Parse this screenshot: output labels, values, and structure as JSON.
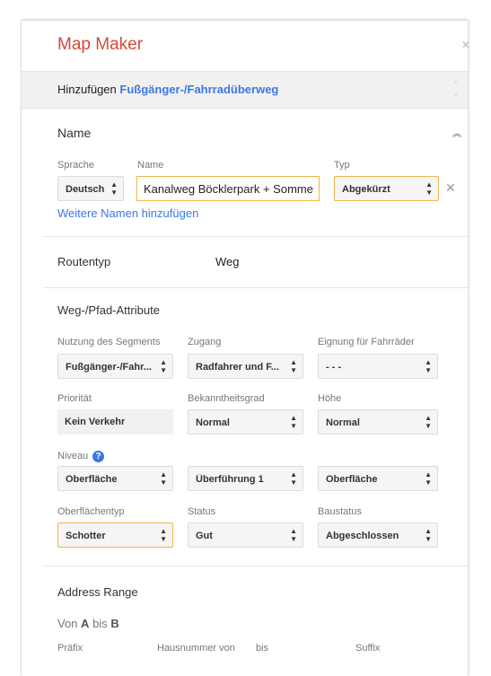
{
  "header": {
    "title": "Map Maker"
  },
  "add_bar": {
    "prefix": "Hinzufügen",
    "feature": "Fußgänger-/Fahrradüberweg"
  },
  "name_section": {
    "title": "Name",
    "lang_label": "Sprache",
    "name_label": "Name",
    "type_label": "Typ",
    "lang_value": "Deutsch",
    "name_value": "Kanalweg Böcklerpark + Somme",
    "type_value": "Abgekürzt",
    "more_link": "Weitere Namen hinzufügen"
  },
  "route": {
    "label": "Routentyp",
    "value": "Weg"
  },
  "attributes": {
    "title": "Weg-/Pfad-Attribute",
    "fields": [
      {
        "label": "Nutzung des Segments",
        "value": "Fußgänger-/Fahr..."
      },
      {
        "label": "Zugang",
        "value": "Radfahrer und F..."
      },
      {
        "label": "Eignung für Fahrräder",
        "value": "- - -"
      },
      {
        "label": "Priorität",
        "value": "Kein Verkehr"
      },
      {
        "label": "Bekanntheitsgrad",
        "value": "Normal"
      },
      {
        "label": "Höhe",
        "value": "Normal"
      },
      {
        "label": "Niveau",
        "value": "Oberfläche"
      },
      {
        "label": "",
        "value": "Überführung 1"
      },
      {
        "label": "",
        "value": "Oberfläche"
      },
      {
        "label": "Oberflächentyp",
        "value": "Schotter"
      },
      {
        "label": "Status",
        "value": "Gut"
      },
      {
        "label": "Baustatus",
        "value": "Abgeschlossen"
      }
    ]
  },
  "address": {
    "title": "Address Range",
    "range_prefix": "Von",
    "from": "A",
    "mid": "bis",
    "to": "B",
    "col_prefix": "Präfix",
    "col_from": "Hausnummer von",
    "col_to": "bis",
    "col_suffix": "Suffix"
  },
  "icons": {
    "close": "close-icon",
    "collapse": "chevron-up-icon",
    "help": "help-icon",
    "remove": "remove-icon"
  }
}
